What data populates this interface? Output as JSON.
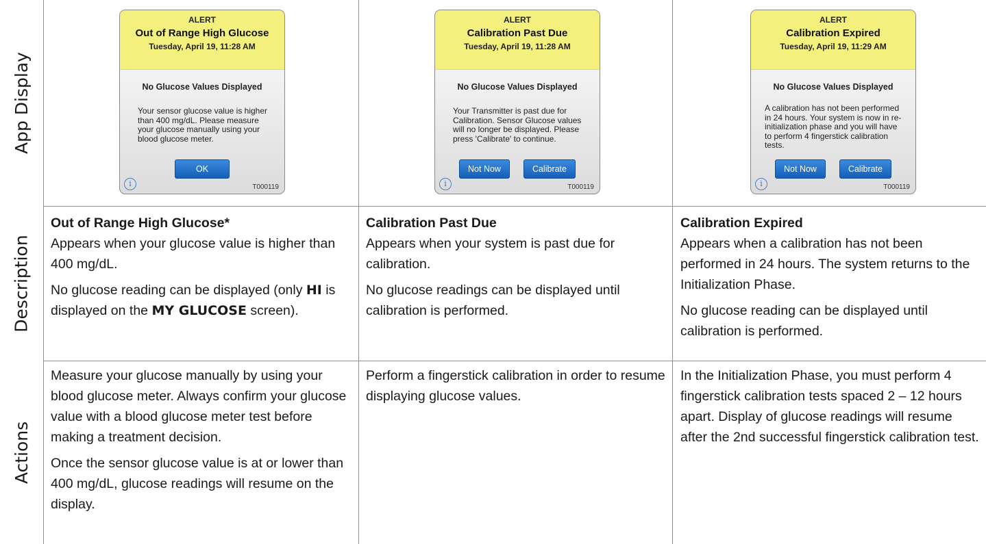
{
  "row_labels": {
    "app_display": "App Display",
    "description": "Description",
    "actions": "Actions"
  },
  "alerts": [
    {
      "alert_word": "ALERT",
      "title": "Out of Range High Glucose",
      "date": "Tuesday, April 19, 11:28 AM",
      "no_values": "No Glucose Values Displayed",
      "message": "Your sensor glucose value is higher than 400 mg/dL. Please measure your glucose manually using your blood glucose meter.",
      "buttons": [
        "OK"
      ],
      "info_icon": "info-icon",
      "code": "T000119"
    },
    {
      "alert_word": "ALERT",
      "title": "Calibration Past Due",
      "date": "Tuesday, April 19, 11:28 AM",
      "no_values": "No Glucose Values Displayed",
      "message": "Your Transmitter is past due for Calibration. Sensor Glucose values will no longer be displayed. Please press 'Calibrate' to continue.",
      "buttons": [
        "Not Now",
        "Calibrate"
      ],
      "info_icon": "info-icon",
      "code": "T000119"
    },
    {
      "alert_word": "ALERT",
      "title": "Calibration Expired",
      "date": "Tuesday, April 19, 11:29 AM",
      "no_values": "No Glucose Values Displayed",
      "message": "A calibration has not been performed in 24 hours. Your system is now in re-initialization phase and you will have to perform 4 fingerstick calibration tests.",
      "buttons": [
        "Not Now",
        "Calibrate"
      ],
      "info_icon": "info-icon",
      "code": "T000119"
    }
  ],
  "descriptions": [
    {
      "heading": "Out of Range High Glucose*",
      "p1": "Appears when your glucose value is higher than 400 mg/dL.",
      "p2_pre": "No glucose reading can be displayed (only ",
      "p2_hi": "HI",
      "p2_mid": " is displayed on the ",
      "p2_screen": "MY GLUCOSE",
      "p2_post": " screen)."
    },
    {
      "heading": "Calibration Past Due",
      "p1": "Appears when your system is past due for calibration.",
      "p2": "No glucose readings can be displayed until calibration is performed."
    },
    {
      "heading": "Calibration Expired",
      "p1": "Appears when a calibration has not been performed in 24 hours. The system returns to the Initialization Phase.",
      "p2": "No glucose reading can be displayed until calibration is performed."
    }
  ],
  "actions": [
    {
      "p1": "Measure your glucose manually by using your blood glucose meter. Always confirm your glucose value with a blood glucose meter test before making a treatment decision.",
      "p2": "Once the sensor glucose value is at or lower than 400 mg/dL, glucose readings will resume on the display."
    },
    {
      "p1": "Perform a fingerstick calibration in order to resume displaying glucose values."
    },
    {
      "p1": "In the Initialization Phase, you must perform 4 fingerstick calibration tests spaced 2 – 12 hours apart. Display of glucose readings will resume after the 2nd successful fingerstick calibration test."
    }
  ]
}
